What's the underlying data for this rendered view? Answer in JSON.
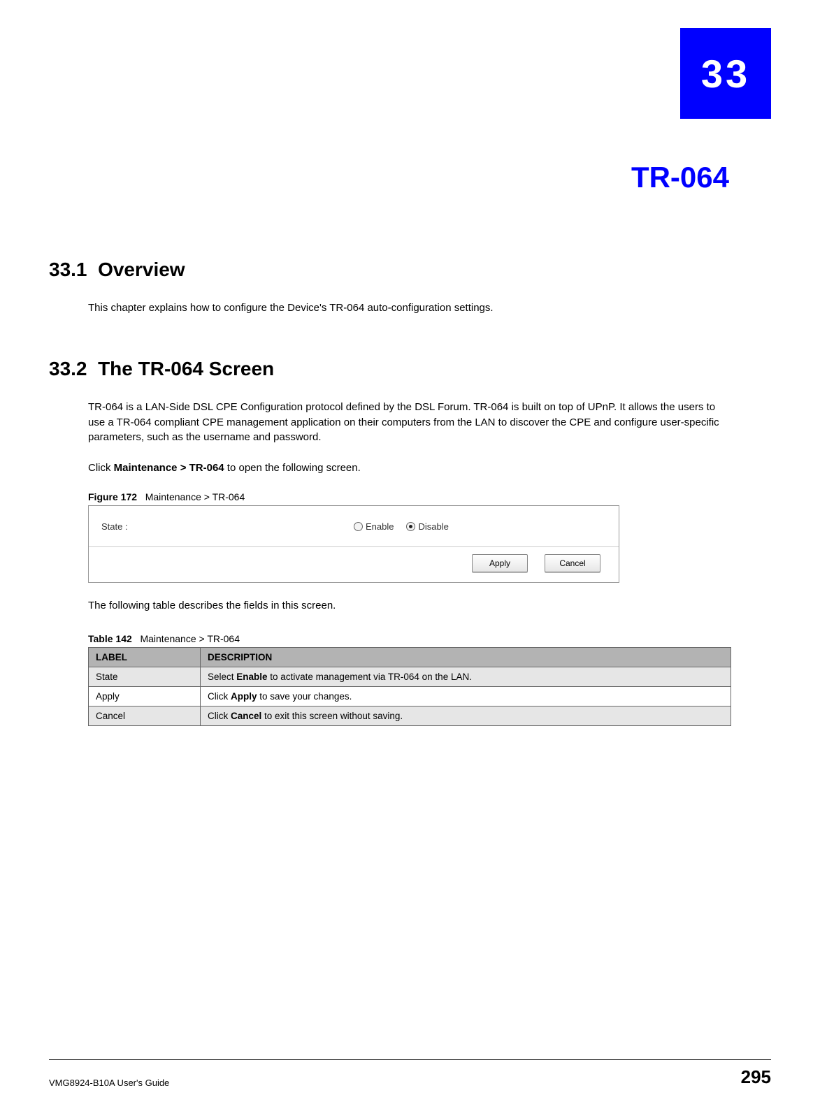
{
  "chapter": {
    "number": "33",
    "title": "TR-064"
  },
  "sections": {
    "s1": {
      "num": "33.1",
      "title": "Overview",
      "p1": "This chapter explains how to configure the Device's TR-064 auto-configuration settings."
    },
    "s2": {
      "num": "33.2",
      "title": "The TR-064 Screen",
      "p1": "TR-064 is a LAN-Side DSL CPE Configuration protocol defined by the DSL Forum. TR-064 is built on top of UPnP. It allows the users to use a TR-064 compliant CPE management application on their computers from the LAN to discover the CPE and configure user-specific parameters, such as the username and password.",
      "p2a": "Click ",
      "p2b": "Maintenance > TR-064",
      "p2c": " to open the following screen."
    }
  },
  "figure": {
    "label": "Figure 172",
    "caption": "Maintenance > TR-064"
  },
  "ui": {
    "state_label": "State :",
    "enable": "Enable",
    "disable": "Disable",
    "apply": "Apply",
    "cancel": "Cancel"
  },
  "posttable": "The following table describes the fields in this screen.",
  "table": {
    "label": "Table 142",
    "caption": "Maintenance > TR-064",
    "head": {
      "c1": "LABEL",
      "c2": "DESCRIPTION"
    },
    "rows": [
      {
        "c1": "State",
        "c2a": "Select ",
        "c2b": "Enable",
        "c2c": " to activate management via TR-064 on the LAN."
      },
      {
        "c1": "Apply",
        "c2a": "Click ",
        "c2b": "Apply",
        "c2c": " to save your changes."
      },
      {
        "c1": "Cancel",
        "c2a": "Click ",
        "c2b": "Cancel",
        "c2c": " to exit this screen without saving."
      }
    ]
  },
  "footer": {
    "left": "VMG8924-B10A User's Guide",
    "right": "295"
  }
}
